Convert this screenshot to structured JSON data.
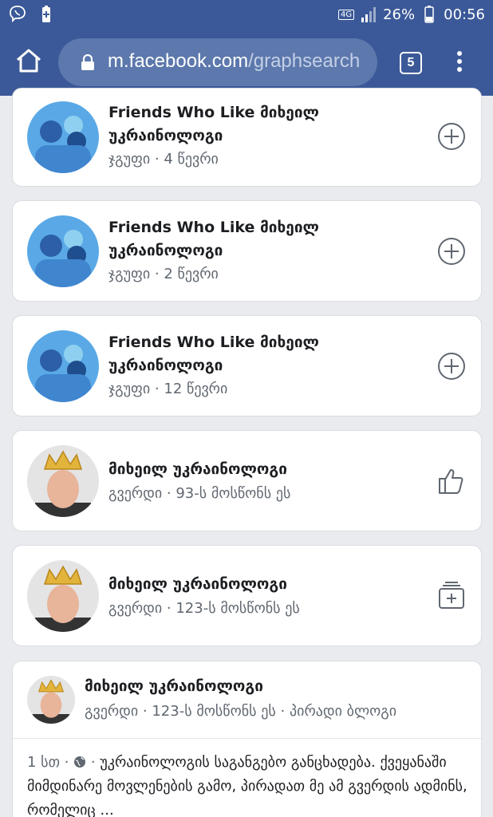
{
  "status_bar": {
    "network": "4G",
    "battery": "26%",
    "time": "00:56",
    "icons": [
      "viber-icon",
      "battery-saver-icon",
      "signal-icon",
      "battery-icon"
    ]
  },
  "browser": {
    "url_domain": "m.facebook.com",
    "url_path": "/graphsearch",
    "tab_count": "5"
  },
  "results": [
    {
      "title": "Friends Who Like მიხეილ უკრაინოლოგი",
      "subtitle": "ჯგუფი · 4 წევრი",
      "avatar": "group-illustration",
      "action": "join-plus-icon"
    },
    {
      "title": "Friends Who Like მიხეილ უკრაინოლოგი",
      "subtitle": "ჯგუფი · 2 წევრი",
      "avatar": "group-illustration",
      "action": "join-plus-icon"
    },
    {
      "title": "Friends Who Like მიხეილ უკრაინოლოგი",
      "subtitle": "ჯგუფი · 12 წევრი",
      "avatar": "group-illustration",
      "action": "join-plus-icon"
    },
    {
      "title": "მიხეილ უკრაინოლოგი",
      "subtitle": "გვერდი · 93-ს მოსწონს ეს",
      "avatar": "man-with-crown-photo",
      "action": "like-thumb-icon"
    },
    {
      "title": "მიხეილ უკრაინოლოგი",
      "subtitle": "გვერდი · 123-ს მოსწონს ეს",
      "avatar": "man-with-crown-photo",
      "action": "add-page-icon"
    }
  ],
  "post": {
    "name": "მიხეილ უკრაინოლოგი",
    "subtitle": "გვერდი · 123-ს მოსწონს ეს · პირადი ბლოგი",
    "time": "1 სთ",
    "privacy_icon": "globe-icon",
    "text": "უკრაინოლოგის საგანგებო განცხადება. ქვეყანაში მიმდინარე მოვლენების გამო, პირადათ მე ამ გვერდის ადმინს, რომელიც ..."
  },
  "colors": {
    "brand": "#3b5998",
    "background": "#e9ebee",
    "text_secondary": "#606770"
  }
}
